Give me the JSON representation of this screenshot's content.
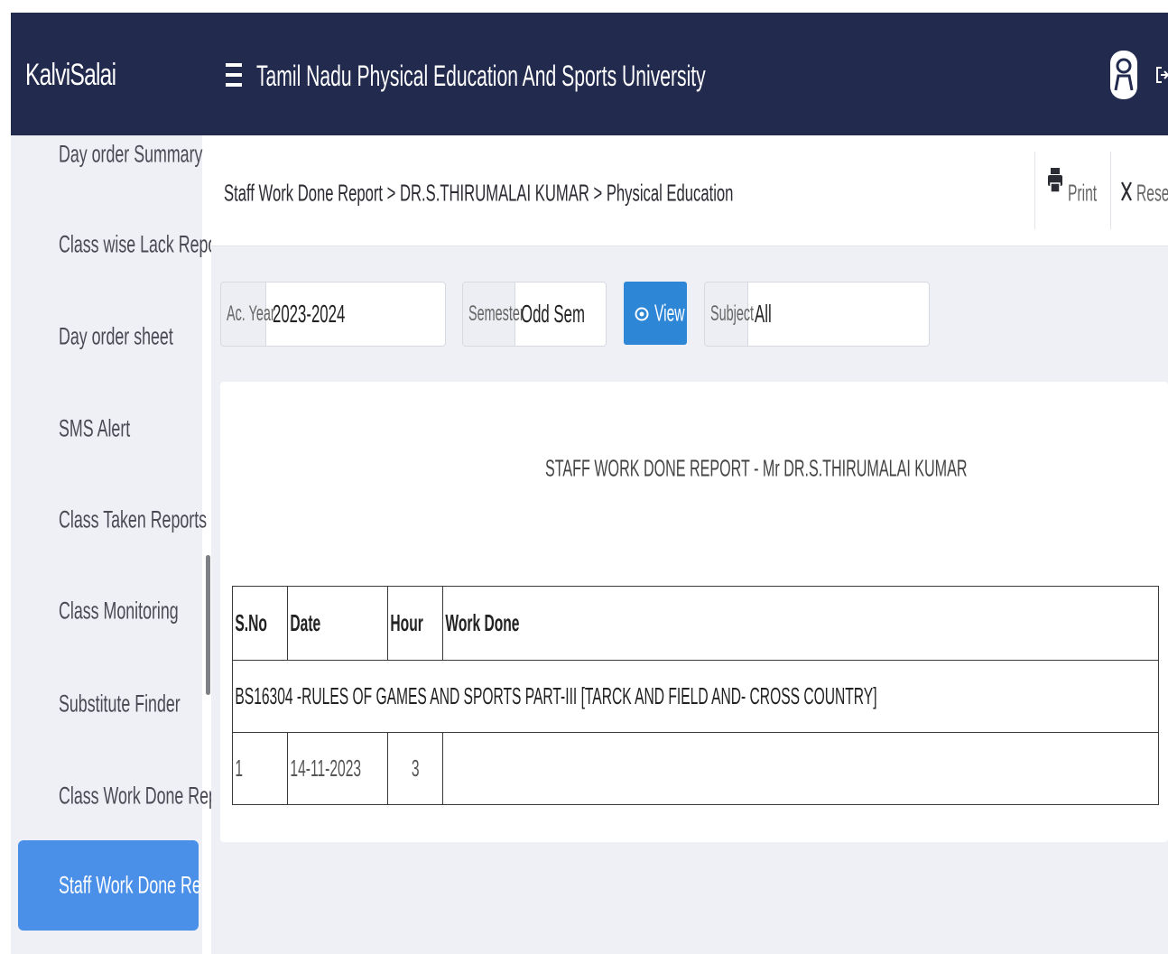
{
  "header": {
    "brand": "KalviSalai",
    "university": "Tamil Nadu Physical Education And Sports University"
  },
  "sidebar": {
    "items": [
      {
        "label": "Day order Summary"
      },
      {
        "label": "Class wise Lack Report"
      },
      {
        "label": "Day order sheet"
      },
      {
        "label": "SMS Alert"
      },
      {
        "label": "Class Taken Reports"
      },
      {
        "label": "Class Monitoring"
      },
      {
        "label": "Substitute Finder"
      },
      {
        "label": "Class Work Done Report"
      },
      {
        "label": "Staff Work Done Report",
        "active": true
      }
    ]
  },
  "breadcrumb": "Staff Work Done Report > DR.S.THIRUMALAI KUMAR > Physical Education",
  "toolbar": {
    "print_label": "Print",
    "reset_label": "Reset"
  },
  "filters": {
    "acyear_label": "Ac. Year",
    "acyear_value": "2023-2024",
    "semester_label": "Semester",
    "semester_value": "Odd Sem",
    "view_label": "View",
    "subject_label": "Subject",
    "subject_value": "All"
  },
  "report": {
    "title": "STAFF WORK DONE REPORT - Mr DR.S.THIRUMALAI KUMAR",
    "columns": [
      "S.No",
      "Date",
      "Hour",
      "Work Done"
    ],
    "group": "BS16304 -RULES OF GAMES AND SPORTS PART-III [TARCK AND FIELD AND- CROSS COUNTRY]",
    "rows": [
      {
        "sno": "1",
        "date": "14-11-2023",
        "hour": "3",
        "work_done": ""
      }
    ]
  },
  "colors": {
    "header_bg": "#222a4e",
    "sidebar_bg": "#eef0f6",
    "active_item": "#4a90e8",
    "view_button": "#2d86d6"
  }
}
